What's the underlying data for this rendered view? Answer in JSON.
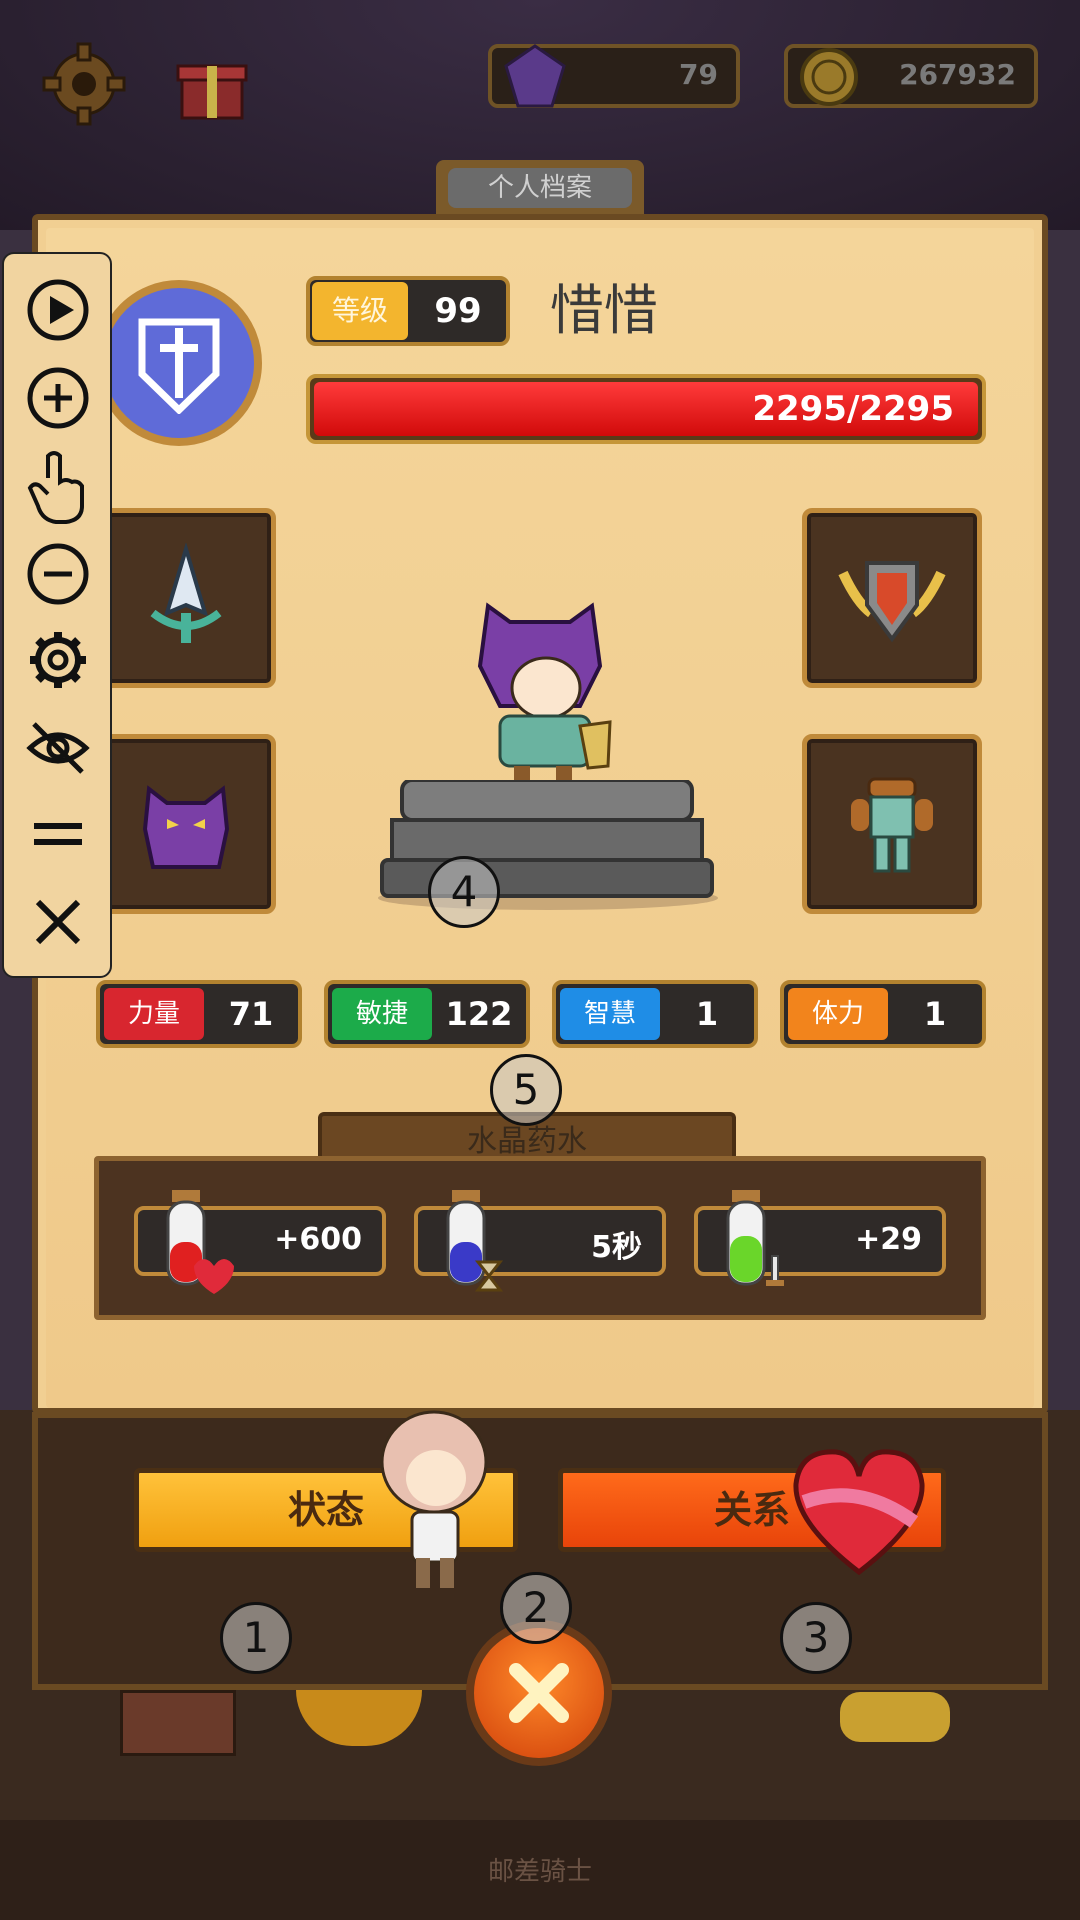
{
  "currency": {
    "gems": "79",
    "coins": "267932",
    "gem_icon": "purple-gem-icon",
    "coin_icon": "gold-coin-icon"
  },
  "top_bar": {
    "settings_icon": "gear-icon",
    "gift_icon": "gift-box-icon"
  },
  "profile": {
    "tab_title": "个人档案",
    "level_label": "等级",
    "level_value": "99",
    "name": "惜惜",
    "hp_text": "2295/2295",
    "hp_fraction": 1.0
  },
  "equipment": {
    "weapon": "spear-tip-icon",
    "shield": "winged-shield-icon",
    "helmet": "cat-hood-helmet-icon",
    "armor": "leather-armor-icon"
  },
  "stats": [
    {
      "label": "力量",
      "value": "71",
      "color": "#d8262f"
    },
    {
      "label": "敏捷",
      "value": "122",
      "color": "#1cab4a"
    },
    {
      "label": "智慧",
      "value": "1",
      "color": "#1f8de6"
    },
    {
      "label": "体力",
      "value": "1",
      "color": "#f2841c"
    }
  ],
  "potions": {
    "title": "水晶药水",
    "items": [
      {
        "value": "+600",
        "icon": "red-potion-heart-icon"
      },
      {
        "value": "5秒",
        "icon": "blue-potion-hourglass-icon"
      },
      {
        "value": "+29",
        "icon": "green-potion-sword-icon"
      }
    ]
  },
  "buttons": {
    "status": "状态",
    "relations": "关系",
    "close_icon": "close-icon"
  },
  "toolbar": [
    "play-icon",
    "zoom-in-icon",
    "touch-icon",
    "zoom-out-icon",
    "gear-icon",
    "eye-off-icon",
    "equals-icon",
    "close-icon"
  ],
  "markers": [
    "1",
    "2",
    "3",
    "4",
    "5"
  ],
  "footer": "邮差骑士"
}
